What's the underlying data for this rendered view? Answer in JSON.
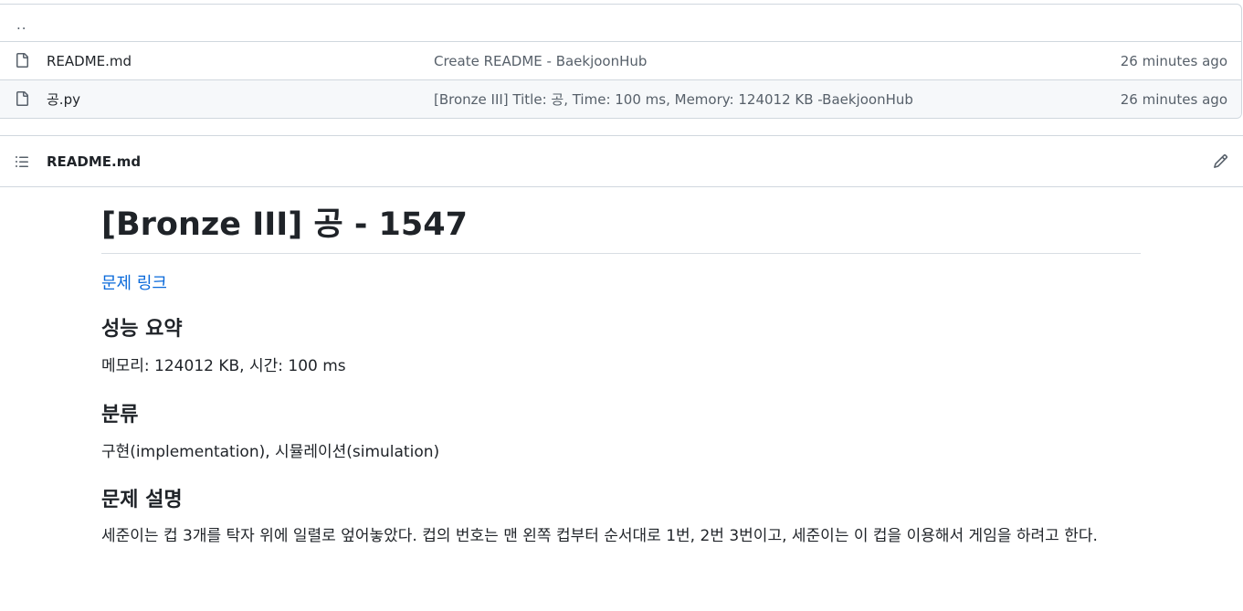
{
  "file_list": {
    "up_link": "..",
    "rows": [
      {
        "name": "README.md",
        "commit": "Create README - BaekjoonHub",
        "age": "26 minutes ago"
      },
      {
        "name": "공.py",
        "commit": "[Bronze III] Title: 공, Time: 100 ms, Memory: 124012 KB -BaekjoonHub",
        "age": "26 minutes ago"
      }
    ]
  },
  "readme": {
    "header_title": "README.md",
    "title": "[Bronze III] 공 - 1547",
    "problem_link": "문제 링크",
    "performance_heading": "성능 요약",
    "performance_text": "메모리: 124012 KB, 시간: 100 ms",
    "category_heading": "분류",
    "category_text": "구현(implementation), 시뮬레이션(simulation)",
    "description_heading": "문제 설명",
    "description_text": "세준이는 컵 3개를 탁자 위에 일렬로 엎어놓았다. 컵의 번호는 맨 왼쪽 컵부터 순서대로 1번, 2번 3번이고, 세준이는 이 컵을 이용해서 게임을 하려고 한다."
  },
  "icons": {
    "file": "file-icon",
    "list": "list-icon",
    "edit": "pencil-icon"
  }
}
